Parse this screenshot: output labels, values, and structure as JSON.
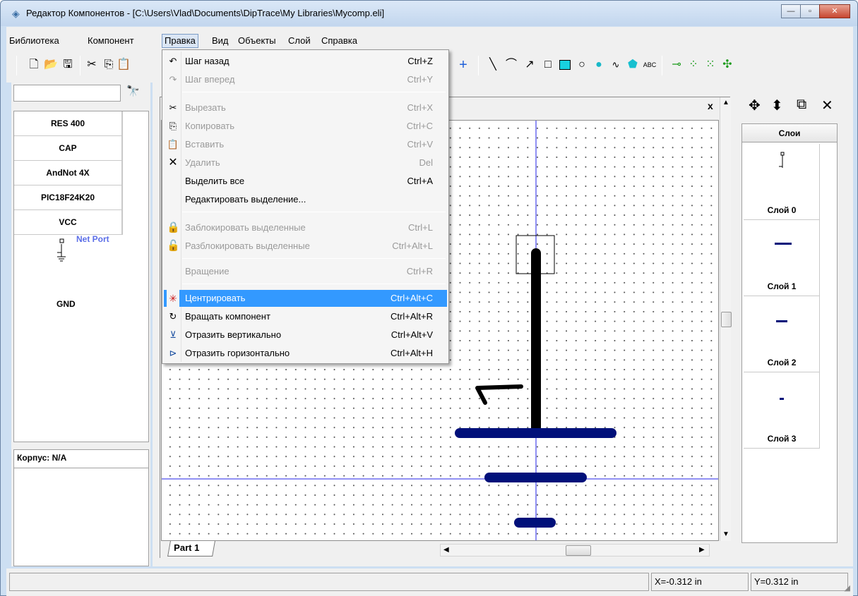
{
  "window": {
    "title": "Редактор Компонентов - [C:\\Users\\Vlad\\Documents\\DipTrace\\My Libraries\\Mycomp.eli]"
  },
  "menubar": {
    "items": [
      "Библиотека",
      "Компонент",
      "Правка",
      "Вид",
      "Объекты",
      "Слой",
      "Справка"
    ]
  },
  "components": {
    "search_value": "",
    "items": [
      "RES 400",
      "CAP",
      "AndNot 4X",
      "PIC18F24K20",
      "VCC"
    ],
    "net_port_label": "Net Port",
    "gnd_label": "GND",
    "package_label": "Корпус: N/A"
  },
  "edit_menu": {
    "items": [
      {
        "icon": "undo-icon",
        "label": "Шаг назад",
        "shortcut": "Ctrl+Z",
        "disabled": false
      },
      {
        "icon": "redo-icon",
        "label": "Шаг вперед",
        "shortcut": "Ctrl+Y",
        "disabled": true
      },
      {
        "icon": "cut-icon",
        "label": "Вырезать",
        "shortcut": "Ctrl+X",
        "disabled": true
      },
      {
        "icon": "copy-icon",
        "label": "Копировать",
        "shortcut": "Ctrl+C",
        "disabled": true
      },
      {
        "icon": "paste-icon",
        "label": "Вставить",
        "shortcut": "Ctrl+V",
        "disabled": true
      },
      {
        "icon": "delete-icon",
        "label": "Удалить",
        "shortcut": "Del",
        "disabled": true
      },
      {
        "icon": "",
        "label": "Выделить все",
        "shortcut": "Ctrl+A",
        "disabled": false
      },
      {
        "icon": "",
        "label": "Редактировать выделение...",
        "shortcut": "",
        "disabled": false
      },
      {
        "icon": "lock-icon",
        "label": "Заблокировать выделенные",
        "shortcut": "Ctrl+L",
        "disabled": true
      },
      {
        "icon": "unlock-icon",
        "label": "Разблокировать выделенные",
        "shortcut": "Ctrl+Alt+L",
        "disabled": true
      },
      {
        "icon": "",
        "label": "Вращение",
        "shortcut": "Ctrl+R",
        "disabled": true
      },
      {
        "icon": "center-icon",
        "label": "Центрировать",
        "shortcut": "Ctrl+Alt+C",
        "disabled": false,
        "highlighted": true
      },
      {
        "icon": "rotate-component-icon",
        "label": "Вращать компонент",
        "shortcut": "Ctrl+Alt+R",
        "disabled": false
      },
      {
        "icon": "flip-vertical-icon",
        "label": "Отразить вертикально",
        "shortcut": "Ctrl+Alt+V",
        "disabled": false
      },
      {
        "icon": "flip-horizontal-icon",
        "label": "Отразить горизонтально",
        "shortcut": "Ctrl+Alt+H",
        "disabled": false
      }
    ]
  },
  "design": {
    "part_tab": "Part 1",
    "close_glyph": "x"
  },
  "layers": {
    "header": "Слои",
    "items": [
      "Слой 0",
      "Слой 1",
      "Слой 2",
      "Слой 3"
    ]
  },
  "status": {
    "x": "X=-0.312 in",
    "y": "Y=0.312 in"
  },
  "colors": {
    "highlight": "#3399ff",
    "shape_blue": "#00107a",
    "axis_blue": "#0000ff",
    "netport_text": "#5b6ee8"
  }
}
